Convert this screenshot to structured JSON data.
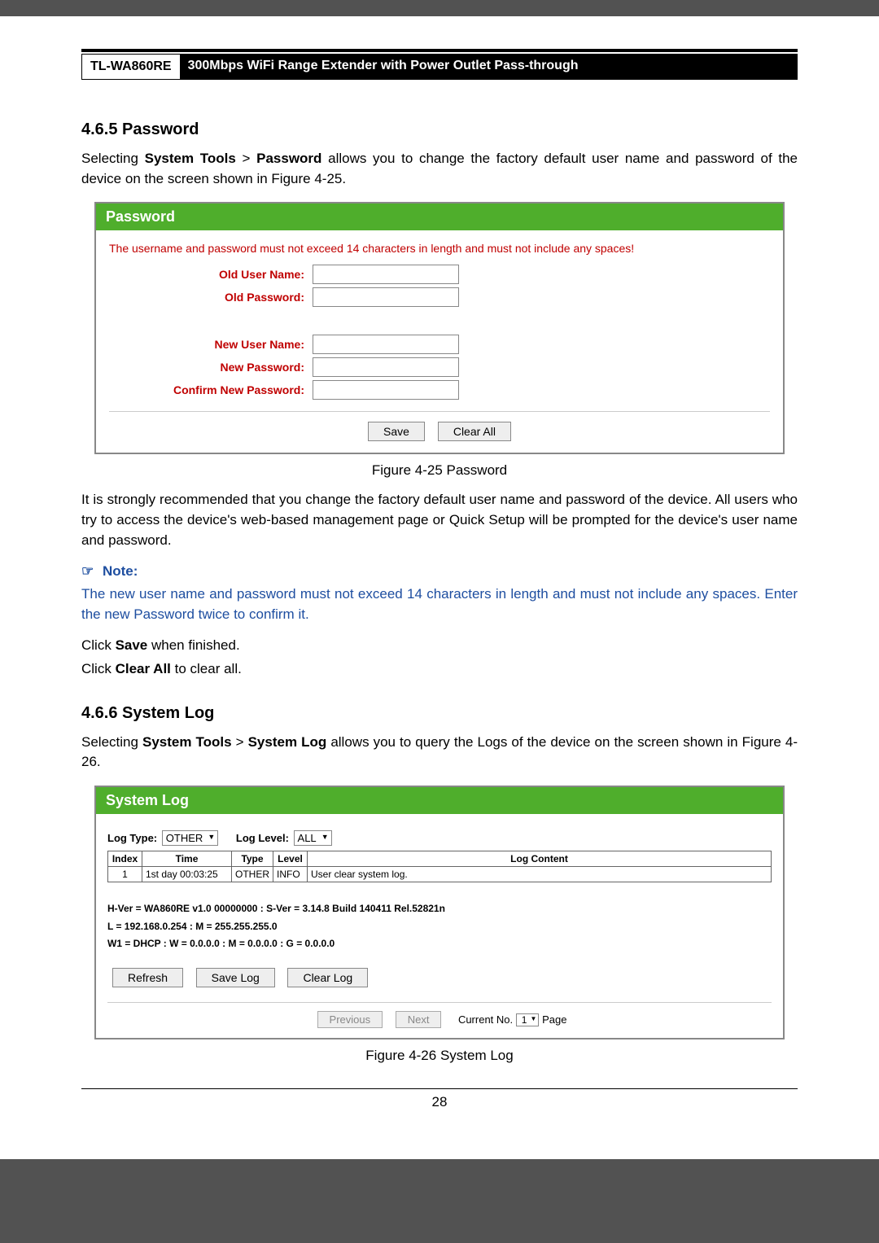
{
  "header": {
    "model": "TL-WA860RE",
    "desc": "300Mbps WiFi Range Extender with Power Outlet Pass-through"
  },
  "section1": {
    "heading": "4.6.5  Password",
    "intro_pre": "Selecting ",
    "intro_b1": "System Tools",
    "intro_mid": " > ",
    "intro_b2": "Password",
    "intro_post": " allows you to change the factory default user name and password of the device on the screen shown in Figure 4-25."
  },
  "password_panel": {
    "title": "Password",
    "warning": "The username and password must not exceed 14 characters in length and must not include any spaces!",
    "old_user": "Old User Name:",
    "old_pw": "Old Password:",
    "new_user": "New User Name:",
    "new_pw": "New Password:",
    "confirm_pw": "Confirm New Password:",
    "save": "Save",
    "clear": "Clear All"
  },
  "fig1": "Figure 4-25 Password",
  "para2": "It is strongly recommended that you change the factory default user name and password of the device. All users who try to access the device's web-based management page or Quick Setup will be prompted for the device's user name and password.",
  "note": {
    "label": "Note:",
    "icon": "☞",
    "text": "The new user name and password must not exceed 14 characters in length and must not include any spaces. Enter the new Password twice to confirm it."
  },
  "para3_pre": "Click ",
  "para3_b": "Save",
  "para3_post": " when finished.",
  "para4_pre": "Click ",
  "para4_b": "Clear All",
  "para4_post": " to clear all.",
  "section2": {
    "heading": "4.6.6  System Log",
    "intro_pre": "Selecting ",
    "intro_b1": "System Tools",
    "intro_mid": " > ",
    "intro_b2": "System Log",
    "intro_post": " allows you to query the Logs of the device on the screen shown in Figure 4-26."
  },
  "syslog_panel": {
    "title": "System Log",
    "log_type_label": "Log Type:",
    "log_type_val": "OTHER",
    "log_level_label": "Log Level:",
    "log_level_val": "ALL",
    "cols": [
      "Index",
      "Time",
      "Type",
      "Level",
      "Log Content"
    ],
    "rows": [
      {
        "index": "1",
        "time": "1st day 00:03:25",
        "type": "OTHER",
        "level": "INFO",
        "content": "User clear system log."
      }
    ],
    "meta1": "H-Ver = WA860RE v1.0 00000000 : S-Ver = 3.14.8 Build 140411 Rel.52821n",
    "meta2": "L = 192.168.0.254 : M = 255.255.255.0",
    "meta3": "W1 = DHCP : W = 0.0.0.0 : M = 0.0.0.0 : G = 0.0.0.0",
    "refresh": "Refresh",
    "save_log": "Save Log",
    "clear_log": "Clear Log",
    "prev": "Previous",
    "next": "Next",
    "current_no": "Current No.",
    "page_sel": "1",
    "page_word": "Page"
  },
  "fig2": "Figure 4-26 System Log",
  "page_number": "28"
}
